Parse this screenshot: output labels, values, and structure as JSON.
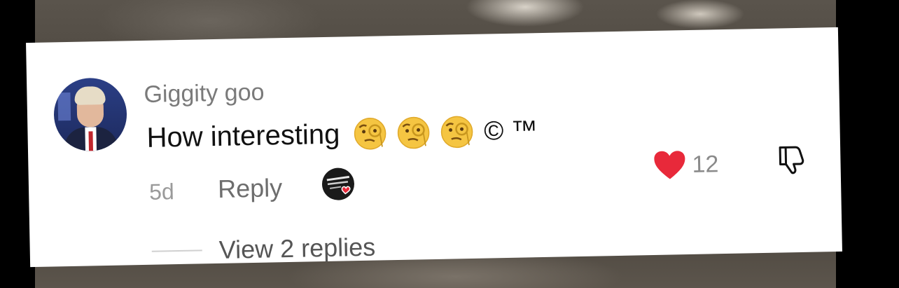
{
  "comment": {
    "username": "Giggity goo",
    "text": "How interesting",
    "emojis": [
      "monocle-face-emoji",
      "monocle-face-emoji",
      "monocle-face-emoji"
    ],
    "symbols": "© ™",
    "age": "5d",
    "reply_label": "Reply",
    "like_count": "12",
    "view_replies_label": "View 2 replies"
  },
  "colors": {
    "like_heart": "#e8293a",
    "card_background": "#ffffff",
    "username": "#7a7a7a",
    "text": "#111111"
  },
  "icons": {
    "like": "heart-icon",
    "dislike": "thumbs-down-icon",
    "creator_liked": "creator-liked-avatar-icon"
  }
}
